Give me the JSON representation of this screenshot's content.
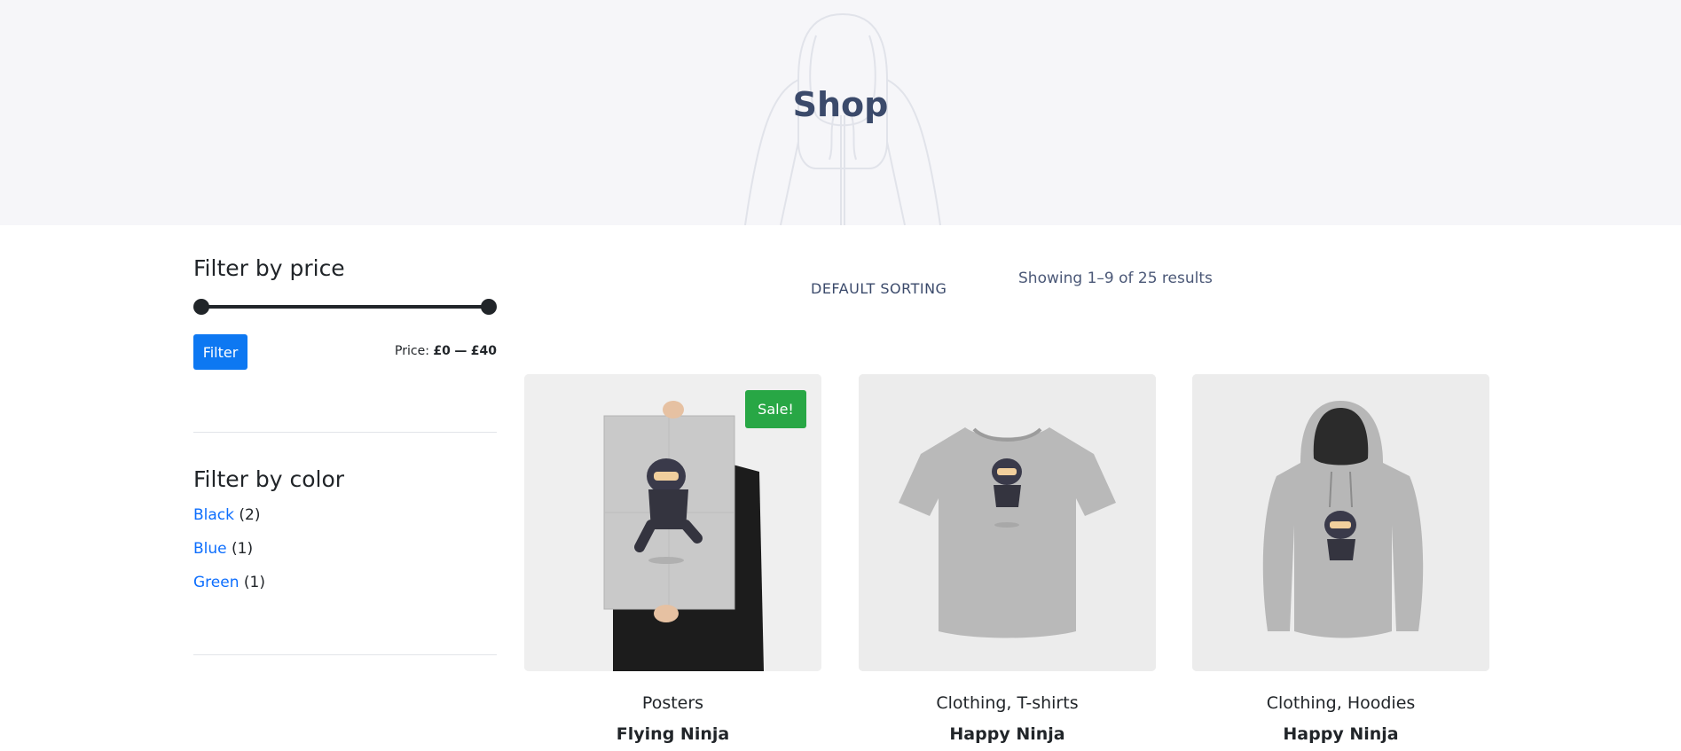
{
  "hero": {
    "title": "Shop"
  },
  "sidebar": {
    "price_widget": {
      "title": "Filter by price",
      "filter_button": "Filter",
      "price_prefix": "Price:",
      "price_min": "£0",
      "price_separator": "—",
      "price_max": "£40"
    },
    "color_widget": {
      "title": "Filter by color",
      "items": [
        {
          "label": "Black",
          "count": "(2)"
        },
        {
          "label": "Blue",
          "count": "(1)"
        },
        {
          "label": "Green",
          "count": "(1)"
        }
      ]
    }
  },
  "toolbar": {
    "sorting_label": "DEFAULT SORTING",
    "results_text": "Showing 1–9 of 25 results"
  },
  "products": [
    {
      "category": "Posters",
      "name": "Flying Ninja",
      "badge": "Sale!",
      "image_icon": "poster-icon"
    },
    {
      "category": "Clothing, T-shirts",
      "name": "Happy Ninja",
      "image_icon": "tshirt-icon"
    },
    {
      "category": "Clothing, Hoodies",
      "name": "Happy Ninja",
      "image_icon": "hoodie-icon"
    }
  ],
  "colors": {
    "accent_blue": "#0d78f2",
    "link_blue": "#0d6efd",
    "sale_green": "#28a745",
    "hero_bg": "#f6f6f9",
    "title_navy": "#3b4a6b"
  }
}
